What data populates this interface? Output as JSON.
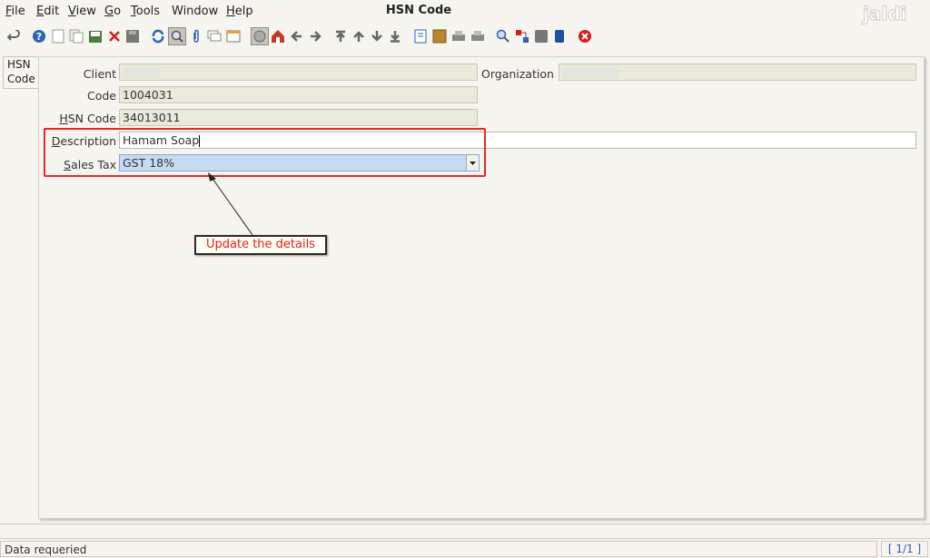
{
  "menu": {
    "items": [
      {
        "label": "File",
        "ul": "F",
        "rest": "ile"
      },
      {
        "label": "Edit",
        "ul": "E",
        "rest": "dit"
      },
      {
        "label": "View",
        "ul": "V",
        "rest": "iew"
      },
      {
        "label": "Go",
        "ul": "G",
        "rest": "o"
      },
      {
        "label": "Tools",
        "ul": "T",
        "rest": "ools"
      },
      {
        "label": "Window",
        "ul": "",
        "rest": "Window"
      },
      {
        "label": "Help",
        "ul": "H",
        "rest": "elp"
      }
    ]
  },
  "window_title": "HSN Code",
  "logo_text": "jaldi",
  "side_tab": {
    "line1": "HSN",
    "line2": "Code"
  },
  "form": {
    "client_label": "Client",
    "organization_label": "Organization",
    "code_label": "Code",
    "code_value": "1004031",
    "hsn_label_ul": "H",
    "hsn_label_rest": "SN Code",
    "hsn_value": "34013011",
    "description_label_ul": "D",
    "description_label_rest": "escription",
    "description_value": "Hamam Soap",
    "salestax_label_ul": "S",
    "salestax_label_rest": "ales Tax",
    "salestax_value": "GST 18%"
  },
  "annotation": {
    "text": "Update the details",
    "color": "#e02020"
  },
  "status": {
    "text": "Data requeried",
    "record_count": "[ 1/1 ]"
  }
}
